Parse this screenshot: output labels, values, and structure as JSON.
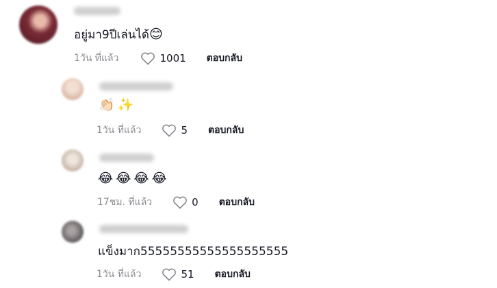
{
  "comments": [
    {
      "text": "อยู่มา9ปีเล่นได้",
      "emoji": "😊",
      "time": "1วัน ที่แล้ว",
      "likes": "1001",
      "reply_label": "ตอบกลับ",
      "avatar_color": "#7a2a35"
    },
    {
      "emojis": [
        "👏🏻",
        "✨"
      ],
      "time": "1วัน ที่แล้ว",
      "likes": "5",
      "reply_label": "ตอบกลับ",
      "avatar_color": "#e3c7b9"
    },
    {
      "emojis": [
        "😂",
        "😂",
        "😂",
        "😂"
      ],
      "time": "17ชม. ที่แล้ว",
      "likes": "0",
      "reply_label": "ตอบกลับ",
      "avatar_color": "#c9b9ab"
    },
    {
      "text": "แข็งมาก55555555555555555555",
      "time": "1วัน ที่แล้ว",
      "likes": "51",
      "reply_label": "ตอบกลับ",
      "avatar_color": "#6b6668"
    }
  ],
  "icons": {
    "like": "heart-outline-icon"
  }
}
